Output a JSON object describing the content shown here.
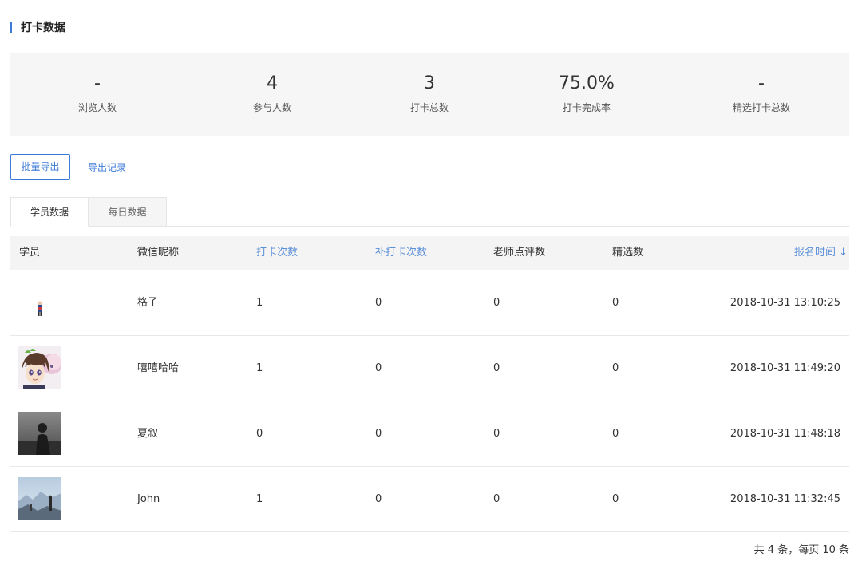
{
  "section": {
    "title": "打卡数据"
  },
  "stats": [
    {
      "value": "-",
      "label": "浏览人数"
    },
    {
      "value": "4",
      "label": "参与人数"
    },
    {
      "value": "3",
      "label": "打卡总数"
    },
    {
      "value": "75.0%",
      "label": "打卡完成率"
    },
    {
      "value": "-",
      "label": "精选打卡总数"
    }
  ],
  "actions": {
    "batch_export": "批量导出",
    "export_log": "导出记录"
  },
  "tabs": [
    {
      "label": "学员数据",
      "active": true
    },
    {
      "label": "每日数据",
      "active": false
    }
  ],
  "table": {
    "headers": {
      "student": "学员",
      "nickname": "微信昵称",
      "checkins": "打卡次数",
      "makeup_checkins": "补打卡次数",
      "teacher_comments": "老师点评数",
      "featured": "精选数",
      "signup_time": "报名时间 ↓"
    },
    "rows": [
      {
        "avatar": "avatar-figure-icon",
        "nickname": "格子",
        "checkins": "1",
        "makeup": "0",
        "comments": "0",
        "featured": "0",
        "time": "2018-10-31 13:10:25"
      },
      {
        "avatar": "avatar-anime-icon",
        "nickname": "嘻嘻哈哈",
        "checkins": "1",
        "makeup": "0",
        "comments": "0",
        "featured": "0",
        "time": "2018-10-31 11:49:20"
      },
      {
        "avatar": "avatar-silhouette-icon",
        "nickname": "夏叙",
        "checkins": "0",
        "makeup": "0",
        "comments": "0",
        "featured": "0",
        "time": "2018-10-31 11:48:18"
      },
      {
        "avatar": "avatar-landscape-icon",
        "nickname": "John",
        "checkins": "1",
        "makeup": "0",
        "comments": "0",
        "featured": "0",
        "time": "2018-10-31 11:32:45"
      }
    ]
  },
  "pagination": {
    "text": "共 4 条，每页 10 条"
  },
  "colors": {
    "accent": "#3b7bd8",
    "sortable_header": "#5a8fd8",
    "panel_bg": "#f6f6f6"
  }
}
